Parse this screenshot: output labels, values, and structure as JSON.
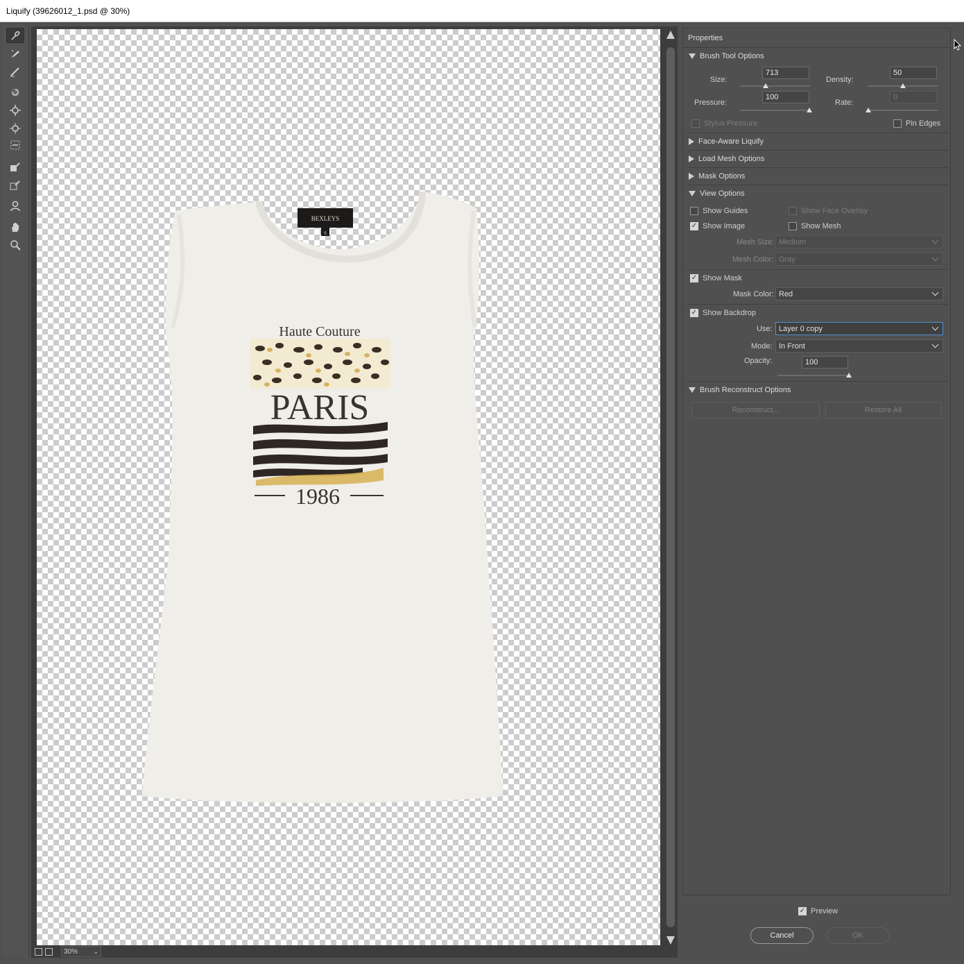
{
  "window": {
    "title": "Liquify (39626012_1.psd @ 30%)"
  },
  "tools": [
    {
      "name": "forward-warp-tool",
      "active": true
    },
    {
      "name": "reconstruct-tool"
    },
    {
      "name": "smooth-tool"
    },
    {
      "name": "twirl-clockwise-tool"
    },
    {
      "name": "pucker-tool"
    },
    {
      "name": "bloat-tool"
    },
    {
      "name": "push-left-tool"
    },
    {
      "name": "freeze-mask-tool"
    },
    {
      "name": "thaw-mask-tool"
    },
    {
      "name": "face-tool"
    },
    {
      "name": "hand-tool"
    },
    {
      "name": "zoom-tool"
    }
  ],
  "canvas": {
    "artwork": {
      "label_tag": "BEXLEYS",
      "size_tag": "S",
      "print_line1": "Haute Couture",
      "print_line2": "PARIS",
      "print_line3": "1986"
    },
    "zoom": "30%"
  },
  "properties": {
    "title": "Properties",
    "brush_tool_options": {
      "heading": "Brush Tool Options",
      "size_label": "Size:",
      "size_value": "713",
      "density_label": "Density:",
      "density_value": "50",
      "pressure_label": "Pressure:",
      "pressure_value": "100",
      "rate_label": "Rate:",
      "rate_value": "0",
      "stylus_pressure": "Stylus Pressure",
      "pin_edges": "Pin Edges"
    },
    "face_aware": "Face-Aware Liquify",
    "load_mesh": "Load Mesh Options",
    "mask_options": "Mask Options",
    "view_options": {
      "heading": "View Options",
      "show_guides": "Show Guides",
      "show_face_overlay": "Show Face Overlay",
      "show_image": "Show Image",
      "show_mesh": "Show Mesh",
      "mesh_size_label": "Mesh Size:",
      "mesh_size_value": "Medium",
      "mesh_color_label": "Mesh Color:",
      "mesh_color_value": "Gray",
      "show_mask": "Show Mask",
      "mask_color_label": "Mask Color:",
      "mask_color_value": "Red",
      "show_backdrop": "Show Backdrop",
      "use_label": "Use:",
      "use_value": "Layer 0 copy",
      "mode_label": "Mode:",
      "mode_value": "In Front",
      "opacity_label": "Opacity:",
      "opacity_value": "100"
    },
    "brush_reconstruct": {
      "heading": "Brush Reconstruct Options",
      "reconstruct": "Reconstruct...",
      "restore_all": "Restore All"
    }
  },
  "footer": {
    "preview": "Preview",
    "cancel": "Cancel",
    "ok": "OK"
  }
}
